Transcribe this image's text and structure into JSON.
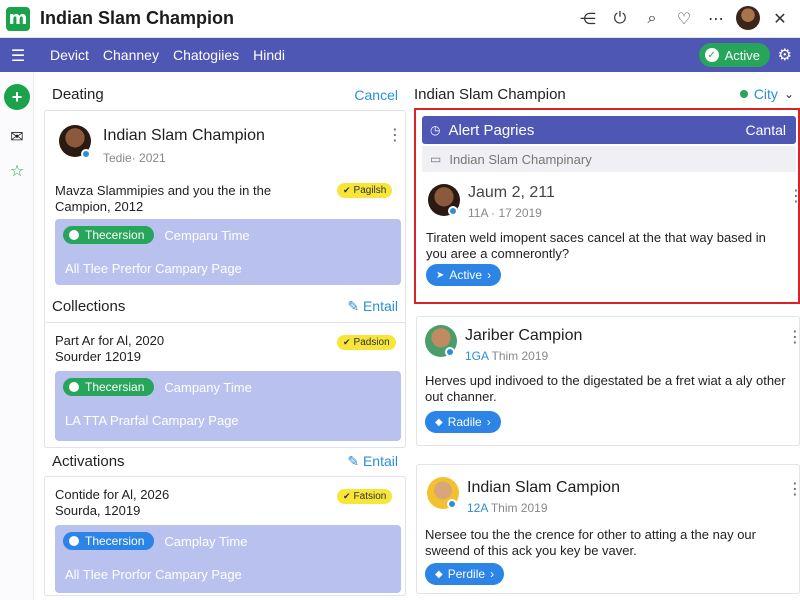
{
  "app": {
    "title": "Indian Slam Champion",
    "logo_glyph": "m"
  },
  "titlebar_icons": [
    "share-icon",
    "power-icon",
    "search-icon",
    "heart-icon",
    "more-icon",
    "avatar",
    "close-icon"
  ],
  "titlebar_glyphs": {
    "share": "⋲",
    "power": "⏻",
    "search": "⌕",
    "heart": "♡",
    "more": "⋯",
    "close": "✕"
  },
  "nav": {
    "menu_glyph": "☰",
    "items": [
      "Devict",
      "Channey",
      "Chatogiies",
      "Hindi"
    ],
    "active_label": "Active",
    "gear_glyph": "⚙"
  },
  "rail": {
    "add_glyph": "+",
    "mail_glyph": "✉",
    "star_glyph": "☆"
  },
  "left": {
    "heading": "Deating",
    "cancel": "Cancel",
    "profile": {
      "name": "Indian Slam Champion",
      "date": "Tedie· 2021",
      "kebab": "⋮"
    },
    "card1": {
      "text1": "Mavza Slammipies and you the in the",
      "text2": "Campion, 2012",
      "badge": "Pagilsh",
      "tag": "Thecersion",
      "tag_label": "Cemparu Time",
      "line2": "All Tlee Prerfor Campary Page"
    },
    "collections": {
      "heading": "Collections",
      "link": "Entail"
    },
    "card2": {
      "text1": "Part Ar for Al, 2020",
      "text2": "Sourder 12019",
      "badge": "Padsion",
      "tag": "Thecersian",
      "tag_label": "Campany Time",
      "line2": "LA TTA Prarfal Campary Page"
    },
    "activations": {
      "heading": "Activations",
      "link": "Entail"
    },
    "card3": {
      "text1": "Contide for Al, 2026",
      "text2": "Sourda, 12019",
      "badge": "Fatsion",
      "tag": "Thecersion",
      "tag_label": "Camplay Time",
      "line2": "All Tlee Prorfor Campary Page"
    }
  },
  "right": {
    "heading": "Indian Slam Champion",
    "city": "City",
    "alert": {
      "title": "Alert Pagries",
      "action": "Cantal",
      "sub": "Indian Slam Champinary",
      "post": {
        "name": "Jaum 2, 211",
        "meta": "11A ·  17 2019",
        "text1": "Tiraten weld imopent saces cancel at the that way based in",
        "text2": "you aree a comnerontly?",
        "button": "Active"
      }
    },
    "post2": {
      "name": "Jariber Campion",
      "meta_tag": "1GA",
      "meta": "Thim 2019",
      "text1": "Herves upd indivoed to the digestated be a fret wiat a aly other",
      "text2": "out channer.",
      "button": "Radile"
    },
    "post3": {
      "name": "Indian Slam Campion",
      "meta_tag": "12A",
      "meta": "Thim 2019",
      "text1": "Nersee tou the the crence for other to atting a the nay our",
      "text2": "sweend of this ack you key be vaver.",
      "button": "Perdile"
    }
  },
  "colors": {
    "nav": "#4e57b4",
    "green": "#1aa34a",
    "alert_border": "#d9232a",
    "link": "#2a8fd6"
  }
}
